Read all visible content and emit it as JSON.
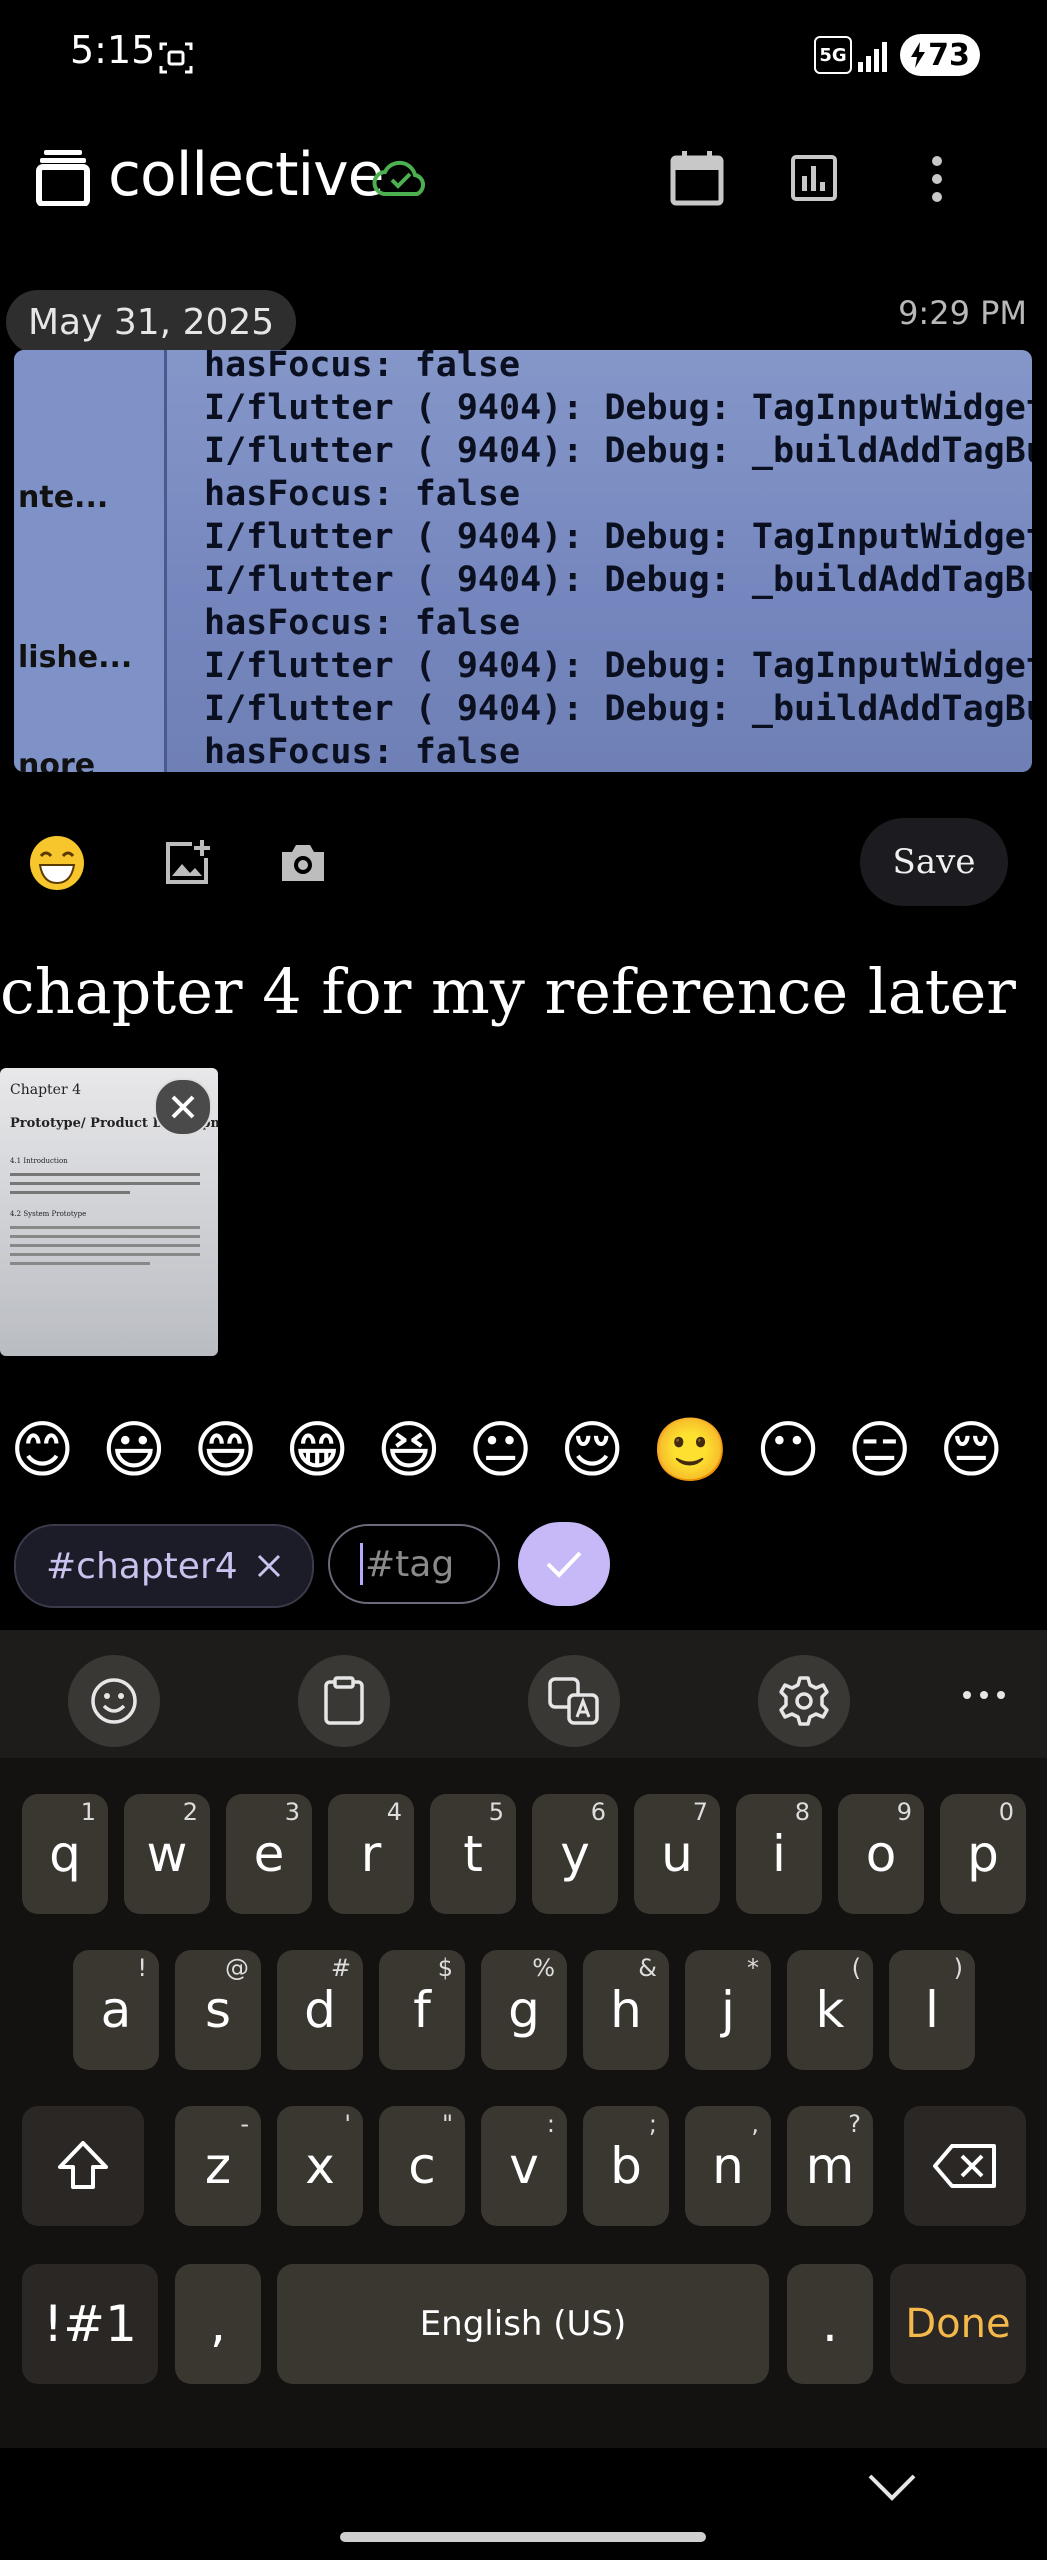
{
  "status_bar": {
    "time": "5:15",
    "network": "5G",
    "battery_level": "73",
    "icons": [
      "screenshot-icon",
      "signal-icon",
      "battery-charging-icon"
    ]
  },
  "app_bar": {
    "title": "collective",
    "icons": [
      "journal-stack-icon",
      "cloud-synced-icon",
      "calendar-icon",
      "chart-icon",
      "more-vert-icon"
    ]
  },
  "entry": {
    "date": "May 31, 2025",
    "time": "9:29 PM",
    "image_code_lines": [
      "hasFocus: false",
      "I/flutter ( 9404): Debug: TagInputWidget bu",
      "I/flutter ( 9404): Debug: _buildAddTagButto",
      "hasFocus: false",
      "I/flutter ( 9404): Debug: TagInputWidget bui",
      "I/flutter ( 9404): Debug: _buildAddTagButton",
      "hasFocus: false",
      "I/flutter ( 9404): Debug: TagInputWidget bui",
      "I/flutter ( 9404): Debug: _buildAddTagButton",
      "hasFocus: false"
    ],
    "image_side_labels": [
      "nte...",
      "lishe...",
      "nore"
    ],
    "note_text": "chapter 4 for my reference later",
    "attachment": {
      "heading": "Chapter 4",
      "title": "Prototype/ Product Development",
      "section_1": "4.1  Introduction",
      "section_2": "4.2  System Prototype"
    }
  },
  "toolbar": {
    "save_label": "Save",
    "icons": [
      "emoji-grin-icon",
      "add-photo-icon",
      "camera-icon"
    ]
  },
  "emoji_row": [
    "😊",
    "😃",
    "😄",
    "😁",
    "😆",
    "😐",
    "😌",
    "🙂",
    "😶",
    "😑",
    "😔",
    "😀"
  ],
  "tags": {
    "chip_label": "#chapter4",
    "input_placeholder": "#tag"
  },
  "keyboard": {
    "row1": [
      [
        "q",
        "1"
      ],
      [
        "w",
        "2"
      ],
      [
        "e",
        "3"
      ],
      [
        "r",
        "4"
      ],
      [
        "t",
        "5"
      ],
      [
        "y",
        "6"
      ],
      [
        "u",
        "7"
      ],
      [
        "i",
        "8"
      ],
      [
        "o",
        "9"
      ],
      [
        "p",
        "0"
      ]
    ],
    "row2": [
      [
        "a",
        "!"
      ],
      [
        "s",
        "@"
      ],
      [
        "d",
        "#"
      ],
      [
        "f",
        "$"
      ],
      [
        "g",
        "%"
      ],
      [
        "h",
        "&"
      ],
      [
        "j",
        "*"
      ],
      [
        "k",
        "("
      ],
      [
        "l",
        ")"
      ]
    ],
    "row3": [
      [
        "z",
        "-"
      ],
      [
        "x",
        "'"
      ],
      [
        "c",
        "\""
      ],
      [
        "v",
        ":"
      ],
      [
        "b",
        ";"
      ],
      [
        "n",
        ","
      ],
      [
        "m",
        "?"
      ]
    ],
    "symbols_label": "!#1",
    "comma_label": ",",
    "space_label": "English (US)",
    "period_label": ".",
    "done_label": "Done",
    "toolbar_icons": [
      "emoji-icon",
      "clipboard-icon",
      "translate-icon",
      "settings-icon",
      "more-horiz-icon"
    ]
  },
  "colors": {
    "accent_purple": "#c7b8f7",
    "sync_green": "#4caf50",
    "done_orange": "#f5b84a"
  }
}
